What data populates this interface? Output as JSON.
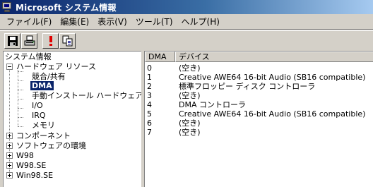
{
  "window": {
    "title": "Microsoft システム情報"
  },
  "menu": [
    {
      "label": "ファイル(F)"
    },
    {
      "label": "編集(E)"
    },
    {
      "label": "表示(V)"
    },
    {
      "label": "ツール(T)"
    },
    {
      "label": "ヘルプ(H)"
    }
  ],
  "toolbar": {
    "buttons": [
      {
        "icon": "save-icon"
      },
      {
        "icon": "print-icon"
      },
      {
        "icon": "exclamation-icon"
      },
      {
        "icon": "copy-icon"
      }
    ]
  },
  "tree": {
    "root": "システム情報",
    "hardware": "ハードウェア リソース",
    "hardware_children": [
      "競合/共有",
      "DMA",
      "手動インストール ハードウェア",
      "I/O",
      "IRQ",
      "メモリ"
    ],
    "selected": "DMA",
    "others": [
      "コンポーネント",
      "ソフトウェアの環境",
      "W98",
      "W98.SE",
      "Win98.SE"
    ]
  },
  "table": {
    "columns": [
      "DMA",
      "デバイス"
    ],
    "rows": [
      {
        "dma": "0",
        "device": "(空き)"
      },
      {
        "dma": "1",
        "device": "Creative AWE64 16-bit Audio (SB16 compatible)"
      },
      {
        "dma": "2",
        "device": "標準フロッピー ディスク コントローラ"
      },
      {
        "dma": "3",
        "device": "(空き)"
      },
      {
        "dma": "4",
        "device": "DMA コントローラ"
      },
      {
        "dma": "5",
        "device": "Creative AWE64 16-bit Audio (SB16 compatible)"
      },
      {
        "dma": "6",
        "device": "(空き)"
      },
      {
        "dma": "7",
        "device": "(空き)"
      }
    ]
  },
  "colors": {
    "titlebar_start": "#0a246a",
    "titlebar_end": "#a6caf0",
    "selection": "#0a246a",
    "face": "#d4d0c8"
  }
}
